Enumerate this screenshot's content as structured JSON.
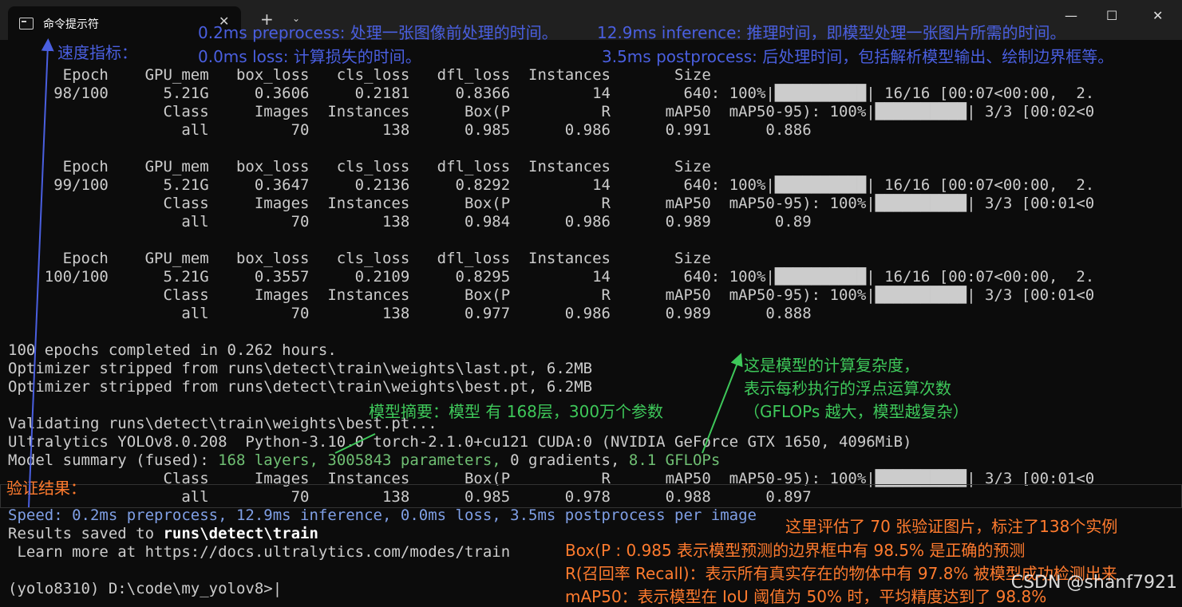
{
  "window": {
    "tab_title": "命令提示符",
    "tab_close": "✕",
    "new_tab": "+",
    "dropdown": "⌄",
    "minimize": "—",
    "maximize": "☐",
    "close": "✕"
  },
  "terminal": {
    "lines": [
      "      Epoch    GPU_mem   box_loss   cls_loss   dfl_loss  Instances       Size",
      "     98/100      5.21G     0.3606     0.2181     0.8366         14        640: 100%|██████████| 16/16 [00:07<00:00,  2.",
      "                 Class     Images  Instances      Box(P          R      mAP50  mAP50-95): 100%|██████████| 3/3 [00:02<0",
      "                   all         70        138      0.985      0.986      0.991      0.886",
      "",
      "      Epoch    GPU_mem   box_loss   cls_loss   dfl_loss  Instances       Size",
      "     99/100      5.21G     0.3647     0.2136     0.8292         14        640: 100%|██████████| 16/16 [00:07<00:00,  2.",
      "                 Class     Images  Instances      Box(P          R      mAP50  mAP50-95): 100%|██████████| 3/3 [00:01<0",
      "                   all         70        138      0.984      0.986      0.989       0.89",
      "",
      "      Epoch    GPU_mem   box_loss   cls_loss   dfl_loss  Instances       Size",
      "    100/100      5.21G     0.3557     0.2109     0.8295         14        640: 100%|██████████| 16/16 [00:07<00:00,  2.",
      "                 Class     Images  Instances      Box(P          R      mAP50  mAP50-95): 100%|██████████| 3/3 [00:01<0",
      "                   all         70        138      0.977      0.986      0.989      0.888",
      "",
      "100 epochs completed in 0.262 hours.",
      "Optimizer stripped from runs\\detect\\train\\weights\\last.pt, 6.2MB",
      "Optimizer stripped from runs\\detect\\train\\weights\\best.pt, 6.2MB",
      "",
      "Validating runs\\detect\\train\\weights\\best.pt...",
      "Ultralytics YOLOv8.0.208  Python-3.10.0 torch-2.1.0+cu121 CUDA:0 (NVIDIA GeForce GTX 1650, 4096MiB)"
    ],
    "summary_prefix": "Model summary (fused): ",
    "summary_layers": "168 layers, 3005843 parameters,",
    "summary_mid": " 0 gradients, ",
    "summary_flops": "8.1 GFLOPs",
    "val_header": "                 Class     Images  Instances      Box(P          R      mAP50  mAP50-95): 100%|██████████| 3/3 [00:01<0",
    "val_all": "                   all         70        138      0.985      0.978      0.988      0.897",
    "speed": "Speed: 0.2ms preprocess, 12.9ms inference, 0.0ms loss, 3.5ms postprocess per image",
    "results_prefix": "Results saved to ",
    "results_path": "runs\\detect\\train",
    "learn_more": " Learn more at https://docs.ultralytics.com/modes/train",
    "prompt": "(yolo8310) D:\\code\\my_yolov8>",
    "cursor": "|"
  },
  "annotations": {
    "preprocess": "0.2ms preprocess: 处理一张图像前处理的时间。",
    "inference": "12.9ms inference: 推理时间，即模型处理一张图片所需的时间。",
    "loss": "0.0ms loss: 计算损失的时间。",
    "postprocess": "3.5ms postprocess: 后处理时间，包括解析模型输出、绘制边界框等。",
    "speed_metric": "速度指标：",
    "summary_note": "模型摘要：模型 有 168层，300万个参数",
    "flops_1": "这是模型的计算复杂度，",
    "flops_2": "表示每秒执行的浮点运算次数",
    "flops_3": "（GFLOPs 越大，模型越复杂）",
    "val_result": "验证结果：",
    "val_1": "这里评估了 70 张验证图片，标注了138个实例",
    "val_2": "Box(P : 0.985 表示模型预测的边界框中有 98.5% 是正确的预测",
    "val_3": "R(召回率 Recall)：表示所有真实存在的物体中有 97.8% 被模型成功检测出来",
    "val_4": "mAP50：表示模型在 IoU 阈值为 50% 时，平均精度达到了 98.8%"
  },
  "watermark": "CSDN @shanf7921",
  "colors": {
    "terminal_bg": "#0c0c0c",
    "annotation_blue": "#4a5fe0",
    "annotation_orange": "#ff7b2e",
    "annotation_green": "#3ec85a"
  }
}
